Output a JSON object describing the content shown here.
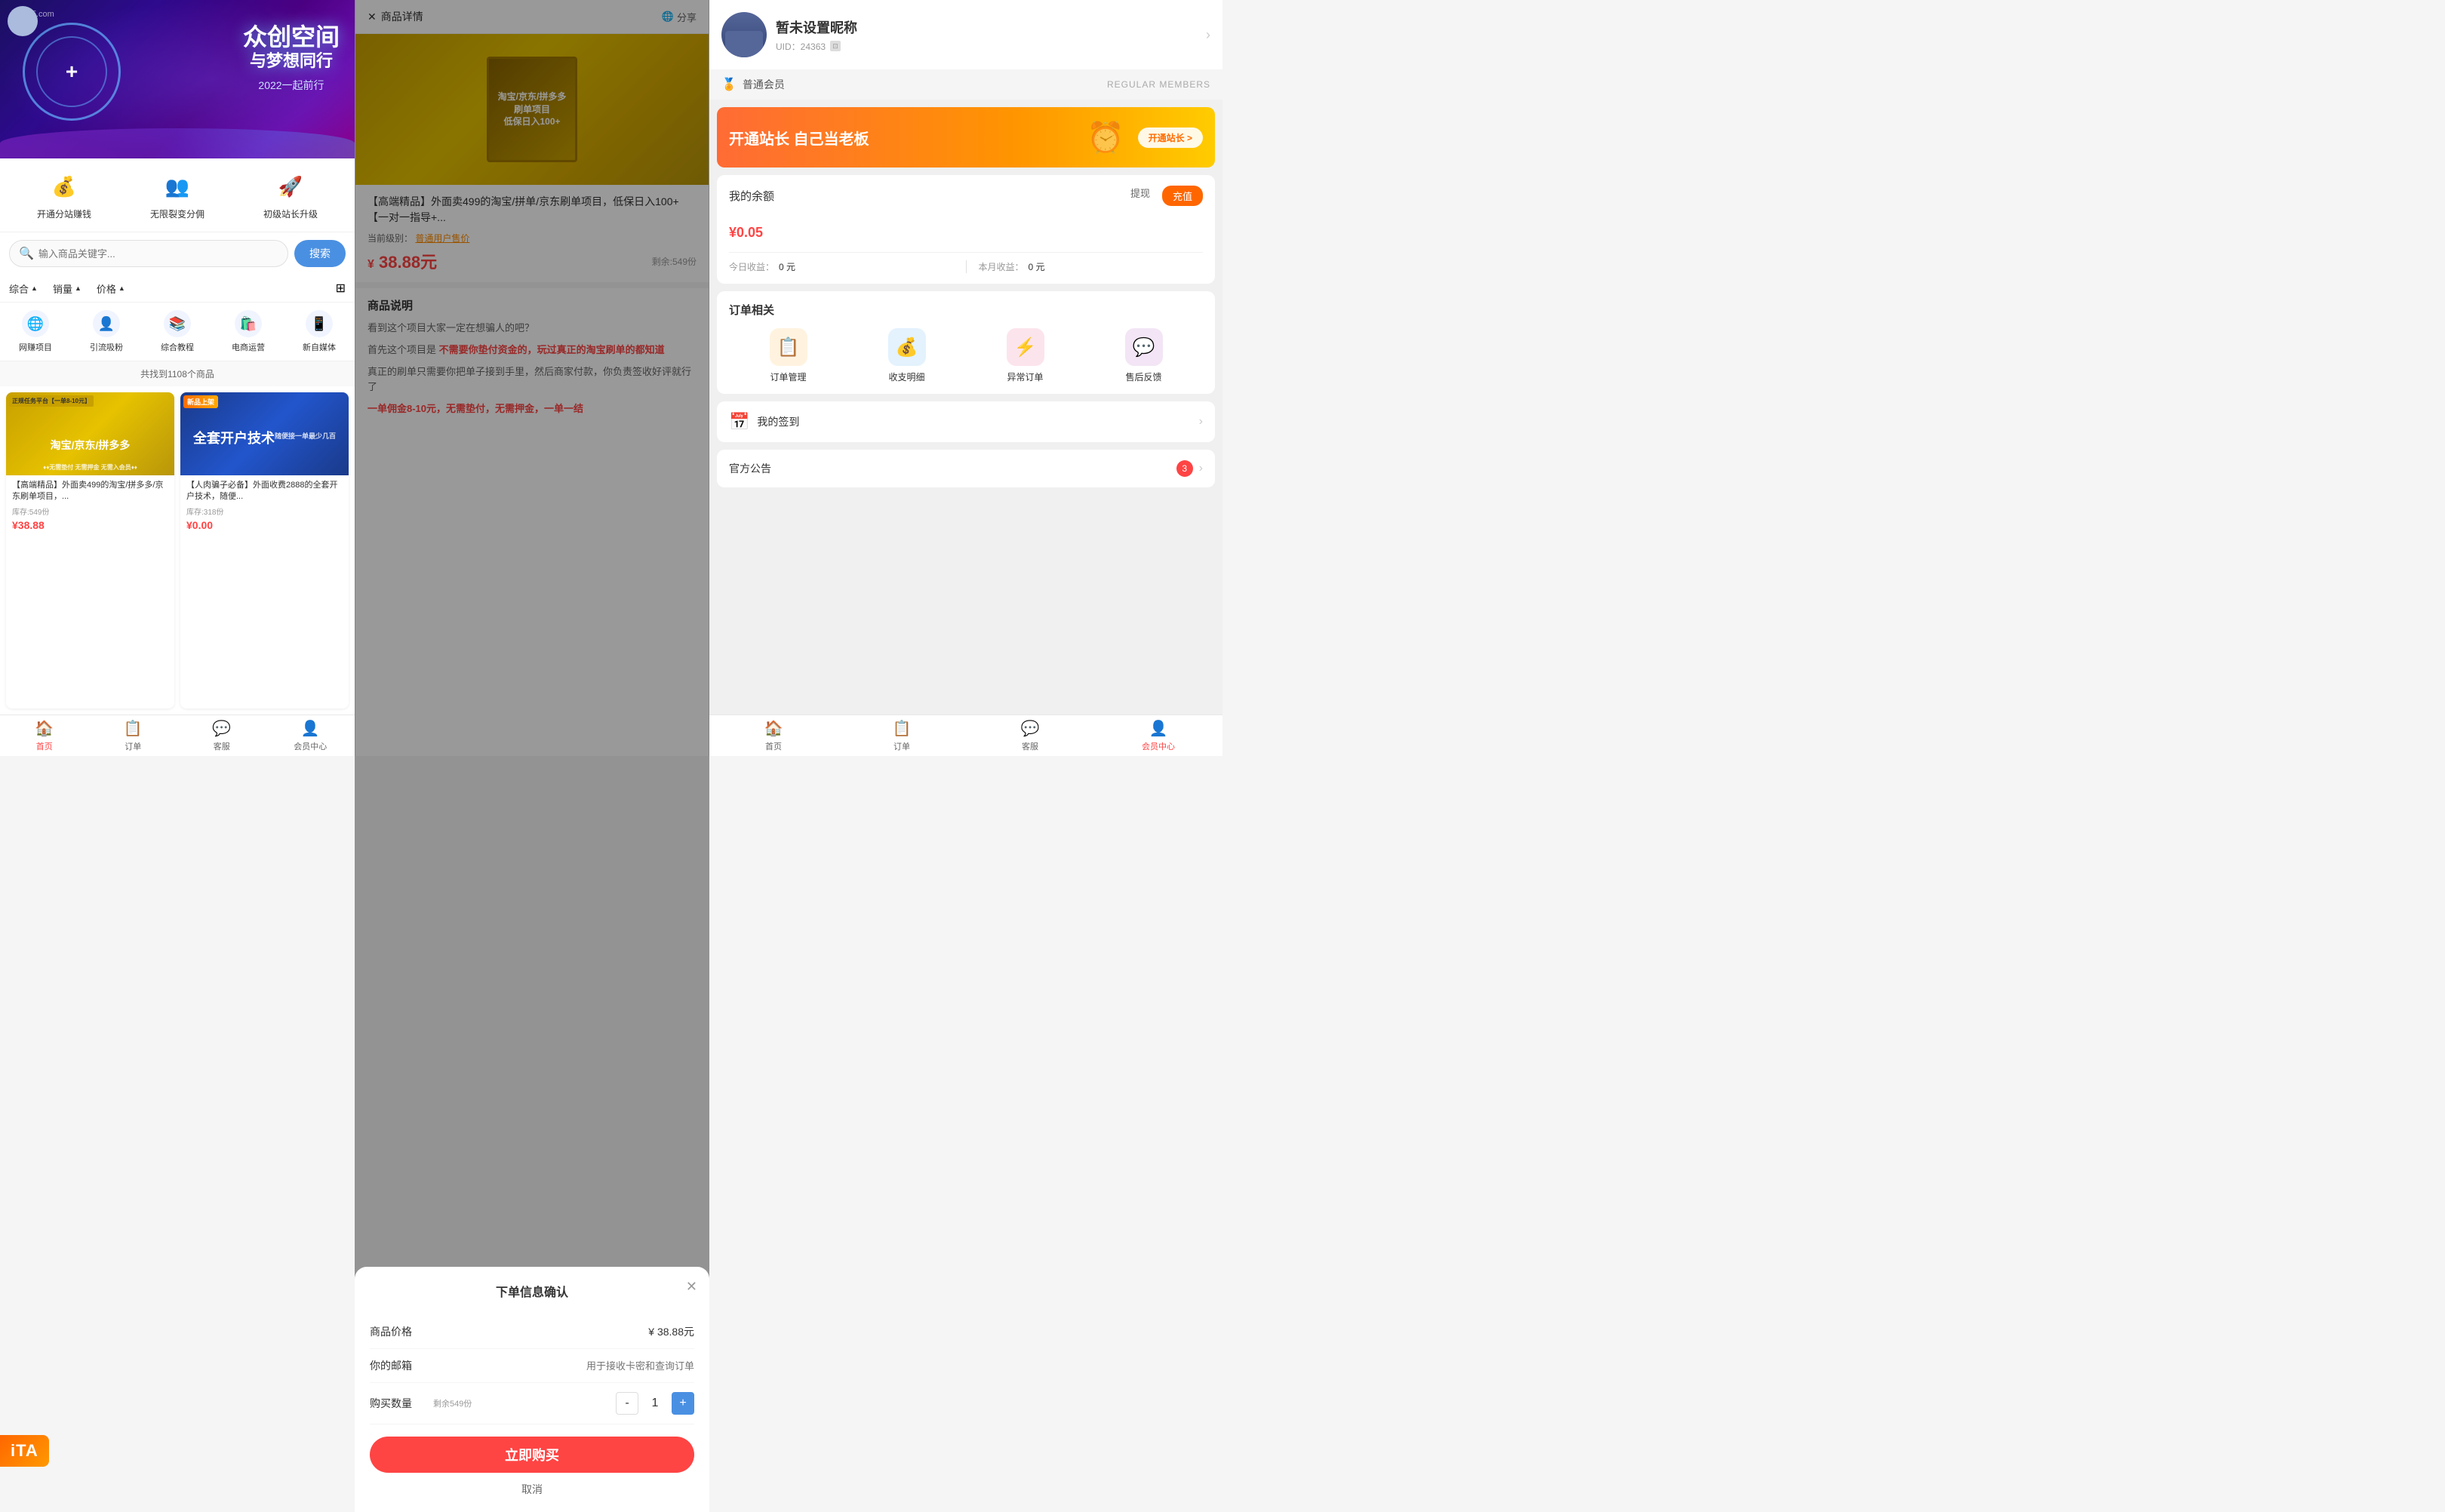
{
  "left": {
    "banner": {
      "logo": "豆有店.com",
      "plus_sign": "+",
      "title": "众创空间",
      "subtitle": "与梦想同行",
      "year_text": "2022一起前行"
    },
    "quick_actions": [
      {
        "id": "earn",
        "icon": "💰",
        "label": "开通分站赚钱"
      },
      {
        "id": "split",
        "icon": "👥",
        "label": "无限裂变分佣"
      },
      {
        "id": "upgrade",
        "icon": "🚀",
        "label": "初级站长升级"
      }
    ],
    "search": {
      "placeholder": "输入商品关键字...",
      "button": "搜索"
    },
    "filters": [
      {
        "label": "综合",
        "arrow": "▲"
      },
      {
        "label": "销量",
        "arrow": "▲"
      },
      {
        "label": "价格",
        "arrow": "▲"
      }
    ],
    "categories": [
      {
        "icon": "🌐",
        "label": "网赚项目"
      },
      {
        "icon": "👤",
        "label": "引流吸粉"
      },
      {
        "icon": "📚",
        "label": "综合教程"
      },
      {
        "icon": "🛍️",
        "label": "电商运营"
      },
      {
        "icon": "📱",
        "label": "新自媒体"
      }
    ],
    "result_count": "共找到1108个商品",
    "products": [
      {
        "id": "p1",
        "name": "【高端精品】外面卖499的淘宝/拼多多/京东刷单项目，...",
        "stock": "库存:549份",
        "price": "¥38.88",
        "badge": "正规任务平台【一单8-10元】",
        "sub_badge": "淘宝/京东/拼多多",
        "desc": "无需垫付 无需押金 无需入会员"
      },
      {
        "id": "p2",
        "name": "【人肉骗子必备】外面收费2888的全套开户技术，随便...",
        "stock": "库存:318份",
        "price": "¥0.00",
        "badge": "新品上架",
        "sub_badge": "全套开户技术",
        "desc": "随便接一单最少几百"
      }
    ],
    "nav": [
      {
        "icon": "🏠",
        "label": "首页",
        "active": true
      },
      {
        "icon": "📋",
        "label": "订单",
        "active": false
      },
      {
        "icon": "💬",
        "label": "客服",
        "active": false
      },
      {
        "icon": "👤",
        "label": "会员中心",
        "active": false
      }
    ]
  },
  "middle": {
    "header": {
      "close_label": "商品详情",
      "share_label": "分享"
    },
    "product": {
      "name": "【高端精品】外面卖499的淘宝/拼单/京东刷单项目，低保日入100+【一对一指导+...",
      "grade_prefix": "当前级别：",
      "grade": "普通用户售价",
      "price": "38.88元",
      "price_symbol": "¥",
      "stock": "剩余:549份"
    },
    "description": {
      "title": "商品说明",
      "line1": "看到这个项目大家一定在想骗人的吧？",
      "line2_pre": "首先这个项目是",
      "line2_highlight": "不需要你垫付资金的，玩过真正的淘宝刷单的都知道",
      "line3": "真正的刷单只需要你把单子接到手里，然后商家付款，你负责签收好评就行了",
      "line4": "一单佣金8-10元，无需垫付，无需押金，一单一结"
    },
    "order_modal": {
      "title": "下单信息确认",
      "price_label": "商品价格",
      "price_value": "¥ 38.88元",
      "email_label": "你的邮箱",
      "email_placeholder": "用于接收卡密和查询订单",
      "qty_label": "购买数量",
      "qty_stock": "剩余549份",
      "qty_value": 1,
      "qty_minus": "-",
      "qty_plus": "+",
      "buy_btn": "立即购买",
      "cancel": "取消"
    }
  },
  "right": {
    "user": {
      "name": "暂未设置昵称",
      "uid": "UID：24363"
    },
    "member": {
      "icon": "🏅",
      "text": "普通会员",
      "label": "REGULAR MEMBERS"
    },
    "station_banner": {
      "title": "开通站长 自己当老板",
      "btn": "开通站长 >"
    },
    "balance": {
      "title": "我的余额",
      "withdraw": "提现",
      "recharge": "充值",
      "amount": "0.05",
      "currency": "¥",
      "today_label": "今日收益：",
      "today_value": "0 元",
      "month_label": "本月收益：",
      "month_value": "0 元"
    },
    "orders": {
      "title": "订单相关",
      "items": [
        {
          "icon": "📋",
          "label": "订单管理",
          "color": "oi-orange"
        },
        {
          "icon": "💰",
          "label": "收支明细",
          "color": "oi-blue"
        },
        {
          "icon": "⚡",
          "label": "异常订单",
          "color": "oi-pink"
        },
        {
          "icon": "💬",
          "label": "售后反馈",
          "color": "oi-purple"
        }
      ]
    },
    "signin": {
      "icon": "📅",
      "text": "我的签到"
    },
    "notice": {
      "text": "官方公告",
      "count": 3
    },
    "nav": [
      {
        "icon": "🏠",
        "label": "首页",
        "active": false
      },
      {
        "icon": "📋",
        "label": "订单",
        "active": false
      },
      {
        "icon": "💬",
        "label": "客服",
        "active": false
      },
      {
        "icon": "👤",
        "label": "会员中心",
        "active": true
      }
    ],
    "ita_text": "iTA"
  }
}
